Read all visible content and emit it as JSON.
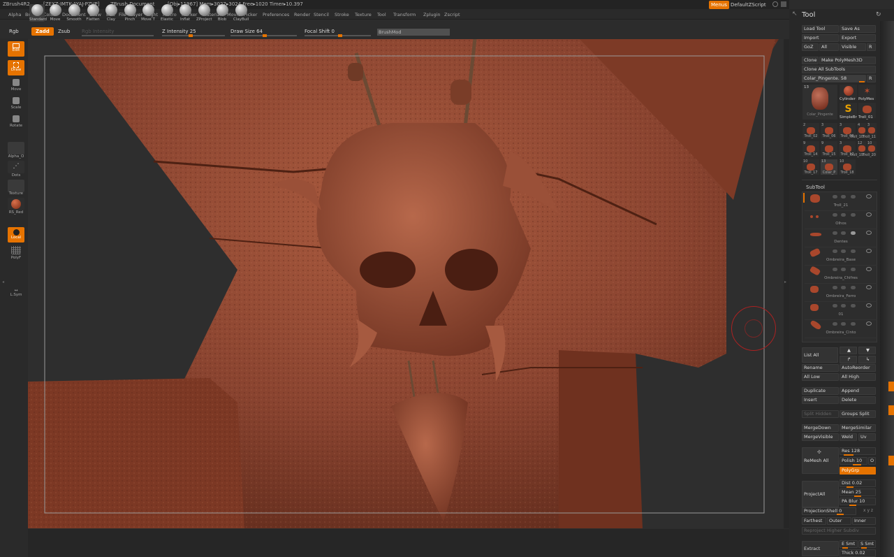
{
  "title_bar": {
    "app": "ZBrush4R2",
    "serial": "[ZEXZ-IMTK-AYAJ-PZVP]",
    "doc": "ZBrush Document",
    "stats": "[Obj▸11967] Mem▸3027▸3024 Free▸1020 Timer▸10.397",
    "menus_btn": "Menus",
    "script": "DefaultZScript"
  },
  "menu": [
    "Alpha",
    "Brush",
    "Color",
    "Document",
    "Draw",
    "Edit",
    "File",
    "Layer",
    "Light",
    "Macro",
    "Marker",
    "Material",
    "Movie",
    "Picker",
    "Preferences",
    "Render",
    "Stencil",
    "Stroke",
    "Texture",
    "Tool",
    "Transform",
    "Zplugin",
    "Zscript"
  ],
  "toolbar": {
    "rgb": "Rgb",
    "zadd": "Zadd",
    "zsub": "Zsub",
    "rgb_intensity": "Rgb Intensity",
    "z_intensity": "Z Intensity 25",
    "draw_size": "Draw Size 64",
    "focal_shift": "Focal Shift 0",
    "brushmod": "BrushMod"
  },
  "left_shelf": {
    "edit": "Edit",
    "draw": "Draw",
    "move": "Move",
    "scale": "Scale",
    "rotate": "Rotate",
    "alpha": "Alpha_O",
    "dots": "Dots",
    "texture": "Texture",
    "material": "RS_Red",
    "local": "Local",
    "polyf": "PolyF",
    "lsym": "L.Sym"
  },
  "brushes": [
    "Standard",
    "Move",
    "Smooth",
    "Flatten",
    "Clay",
    "Pinch",
    "Move T",
    "Elastic",
    "Inflat",
    "ZProject",
    "Blob",
    "ClayBuil"
  ],
  "tool": {
    "title": "Tool",
    "load_tool": "Load Tool",
    "save_as": "Save As",
    "import": "Import",
    "export": "Export",
    "goz": "GoZ",
    "all": "All",
    "visible": "Visible",
    "r": "R",
    "clone": "Clone",
    "make_polymesh": "Make PolyMesh3D",
    "clone_all": "Clone All SubTools",
    "current": "Colar_Pingente. 58",
    "thumbs": {
      "big_num": "13",
      "big_name": "Colar_Pingente",
      "cylinder": "Cylinder",
      "polymes": "PolyMes",
      "simplebr": "SimpleBr",
      "troll01": "Troll_01",
      "row3": [
        "Troll_02",
        "Troll_06",
        "Troll_08",
        "Troll_10",
        "Troll_11"
      ],
      "row3_nums": [
        "2",
        "3",
        "3",
        "4",
        "3"
      ],
      "row4": [
        "Troll_14",
        "Troll_15",
        "Troll_17",
        "Troll_19",
        "Troll_20"
      ],
      "row4_nums": [
        "9",
        "9",
        "3",
        "12",
        "10"
      ],
      "row5": [
        "Troll_17",
        "Colar_P",
        "Troll_18"
      ],
      "row5_nums": [
        "10",
        "13",
        "10"
      ]
    }
  },
  "subtool": {
    "title": "SubTool",
    "items": [
      "Troll_21",
      "Olhos",
      "Dentes",
      "Ombreira_Base",
      "Ombreira_Chifres",
      "Ombreira_Ferro",
      "01",
      "Ombreira_Cinto"
    ]
  },
  "buttons": {
    "list_all": "List All",
    "rename": "Rename",
    "autoreorder": "AutoReorder",
    "all_low": "All Low",
    "all_high": "All High",
    "duplicate": "Duplicate",
    "append": "Append",
    "insert": "Insert",
    "delete": "Delete",
    "split_hidden": "Split Hidden",
    "groups_split": "Groups Split",
    "mergedown": "MergeDown",
    "mergesimilar": "MergeSimilar",
    "mergevisible": "MergeVisible",
    "weld": "Weld",
    "uv": "Uv",
    "remesh_all": "ReMesh All",
    "res": "Res 128",
    "polish": "Polish 10",
    "o": "O",
    "polygrp": "PolyGrp",
    "projectall": "ProjectAll",
    "dist": "Dist 0.02",
    "mean": "Mean 25",
    "pa_blur": "PA Blur 10",
    "projectionshell": "ProjectionShell 0",
    "farthest": "Farthest",
    "outer": "Outer",
    "inner": "Inner",
    "reproject": "Reproject Higher Subdiv",
    "extract": "Extract",
    "e_smt": "E Smt",
    "s_smt": "S Smt",
    "thick": "Thick 0.02"
  },
  "colors": {
    "accent": "#e67300",
    "sculpt": "#8a4630",
    "background": "#2e2e2e"
  }
}
